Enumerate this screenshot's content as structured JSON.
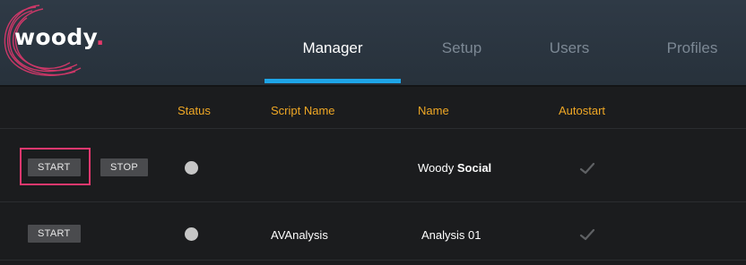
{
  "app": {
    "logo_text": "woody",
    "logo_dot": "."
  },
  "nav": {
    "tabs": [
      {
        "label": "Manager",
        "active": true
      },
      {
        "label": "Setup",
        "active": false
      },
      {
        "label": "Users",
        "active": false
      },
      {
        "label": "Profiles",
        "active": false
      }
    ]
  },
  "table": {
    "headers": {
      "status": "Status",
      "script_name": "Script Name",
      "name": "Name",
      "autostart": "Autostart"
    },
    "rows": [
      {
        "start_label": "START",
        "stop_label": "STOP",
        "status": "stopped",
        "script_name": "",
        "name_prefix": "Woody",
        "name_bold": "Social",
        "autostart": true
      },
      {
        "start_label": "START",
        "status": "stopped",
        "script_name": "AVAnalysis",
        "name_prefix": "Analysis 01",
        "name_bold": "",
        "autostart": true
      }
    ]
  },
  "colors": {
    "accent_underline": "#1ea5e8",
    "header_text": "#f0a825",
    "highlight": "#e8386f",
    "brand_dot": "#e53a6b"
  }
}
